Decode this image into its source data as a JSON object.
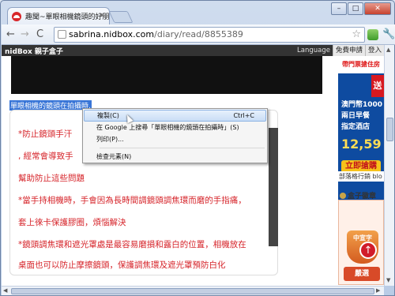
{
  "window": {
    "tab_title": "趣聞~單眼相機鏡頭的好朋",
    "tab_close": "×",
    "controls": {
      "minimize": "–",
      "maximize": "□",
      "close": "✕"
    }
  },
  "toolbar": {
    "back": "←",
    "forward": "→",
    "reload": "C",
    "url_host": "sabrina.nidbox.com",
    "url_path": "/diary/read/8855389",
    "star": "☆",
    "wrench": "🔧"
  },
  "site": {
    "brand": "nidBox 親子盒子",
    "top_links": [
      "Language",
      "免費申請",
      "登入"
    ]
  },
  "article": {
    "selected_caption": "單眼相機的鏡頭在拍攝時,",
    "paragraphs": [
      "*防止鏡頭手汗",
      ", 經常會導致手",
      "幫助防止這些問題",
      "*當手持相機時，手會因為長時間調鏡頭調焦環而磨的手指痛，",
      "套上徠卡保護膠圈，煩惱解決",
      "*鏡頭調焦環和遮光罩處是最容易磨損和露白的位置，相機放在",
      "桌面也可以防止摩擦鏡頭，保護調焦環及遮光罩預防白化"
    ]
  },
  "context_menu": {
    "items": [
      {
        "label": "複製(C)",
        "shortcut": "Ctrl+C"
      },
      {
        "label": "在 Google 上搜尋「單眼相機的鏡頭在拍攝時」(S)",
        "shortcut": ""
      },
      {
        "label": "列印(P)...",
        "shortcut": ""
      },
      {
        "label": "檢查元素(N)",
        "shortcut": ""
      }
    ]
  },
  "sidebar": {
    "ad_top": "帶門票搶住房",
    "ad_badge": "送",
    "ad_lines": [
      "澳門幣1000",
      "兩日早餐",
      "指定酒店"
    ],
    "ad_price": "12,59",
    "ad_button": "立即搶購",
    "note": "部落格行銷 blo",
    "section_title": "盒子徽章",
    "badge_text": "中宣字",
    "badge_more": "嚴選",
    "up_arrow": "↑"
  }
}
